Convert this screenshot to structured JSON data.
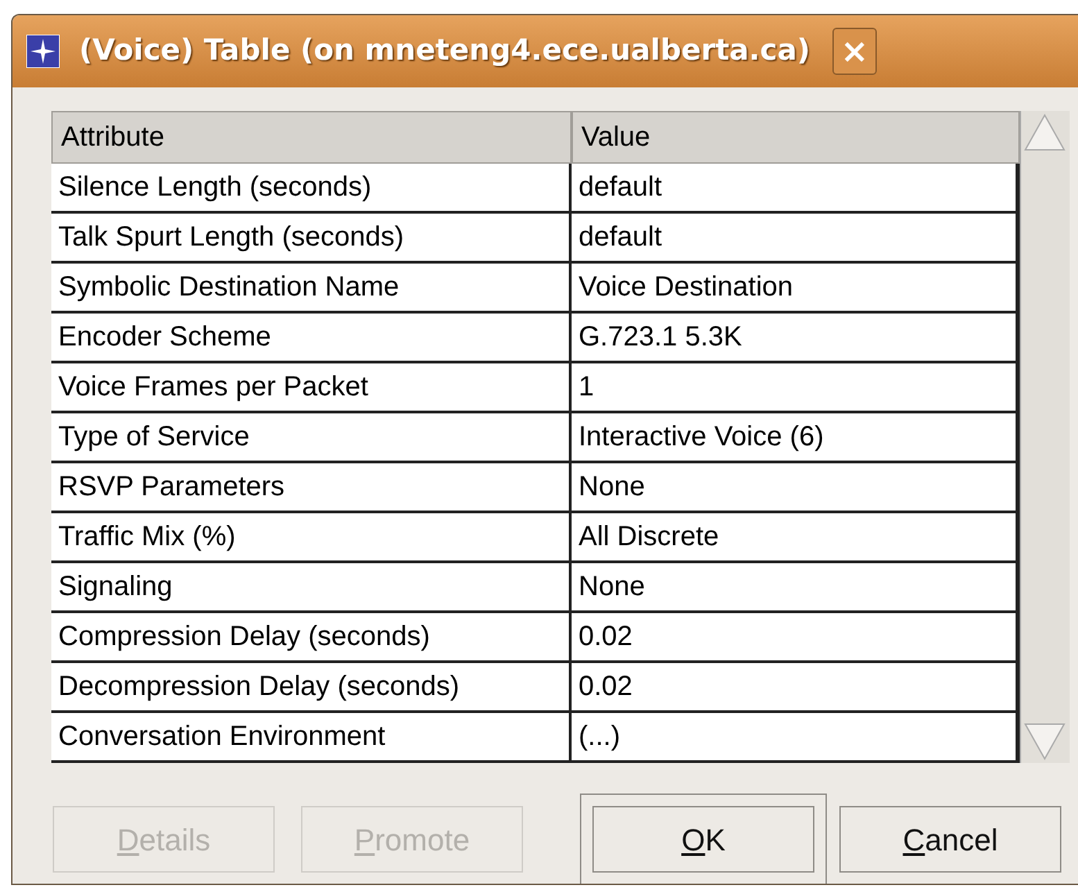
{
  "window": {
    "title": "(Voice) Table (on mneteng4.ece.ualberta.ca)",
    "close": "×"
  },
  "table": {
    "columns": [
      "Attribute",
      "Value"
    ],
    "rows": [
      {
        "attribute": "Silence Length (seconds)",
        "value": "default"
      },
      {
        "attribute": "Talk Spurt Length (seconds)",
        "value": "default"
      },
      {
        "attribute": "Symbolic Destination Name",
        "value": "Voice Destination"
      },
      {
        "attribute": "Encoder Scheme",
        "value": "G.723.1 5.3K"
      },
      {
        "attribute": "Voice Frames per Packet",
        "value": "1"
      },
      {
        "attribute": "Type of Service",
        "value": "Interactive Voice (6)"
      },
      {
        "attribute": "RSVP Parameters",
        "value": "None"
      },
      {
        "attribute": "Traffic Mix (%)",
        "value": "All Discrete"
      },
      {
        "attribute": "Signaling",
        "value": "None"
      },
      {
        "attribute": "Compression Delay (seconds)",
        "value": "0.02"
      },
      {
        "attribute": "Decompression Delay (seconds)",
        "value": "0.02"
      },
      {
        "attribute": "Conversation Environment",
        "value": "(...)"
      }
    ]
  },
  "buttons": [
    {
      "label": "Details",
      "disabled": true,
      "default": false
    },
    {
      "label": "Promote",
      "disabled": true,
      "default": false
    },
    {
      "label": "OK",
      "disabled": false,
      "default": true
    },
    {
      "label": "Cancel",
      "disabled": false,
      "default": false
    }
  ]
}
